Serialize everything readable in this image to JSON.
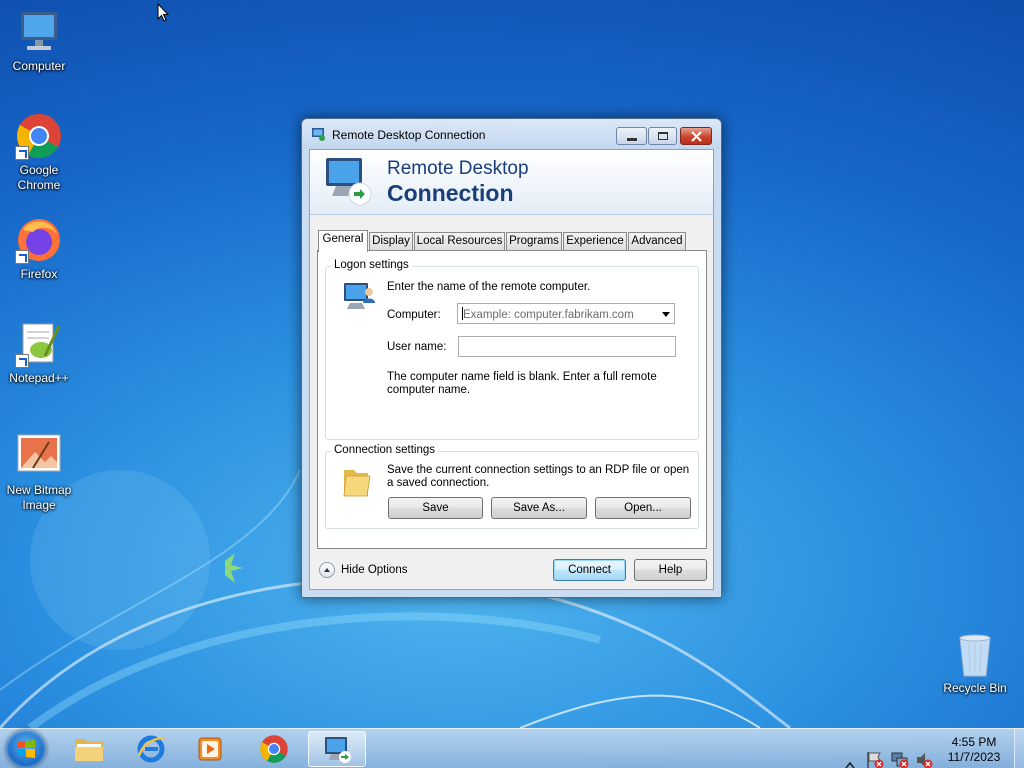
{
  "desktop": {
    "icons": [
      {
        "label": "Computer",
        "icon": "computer-icon"
      },
      {
        "label": "Google Chrome",
        "icon": "chrome-icon"
      },
      {
        "label": "Firefox",
        "icon": "firefox-icon"
      },
      {
        "label": "Notepad++",
        "icon": "notepadpp-icon"
      },
      {
        "label": "New Bitmap Image",
        "icon": "bitmap-image-icon"
      },
      {
        "label": "Recycle Bin",
        "icon": "recycle-bin-icon"
      }
    ]
  },
  "window": {
    "title": "Remote Desktop Connection",
    "banner_line1": "Remote Desktop",
    "banner_line2": "Connection",
    "tabs": [
      {
        "label": "General",
        "active": true
      },
      {
        "label": "Display"
      },
      {
        "label": "Local Resources"
      },
      {
        "label": "Programs"
      },
      {
        "label": "Experience"
      },
      {
        "label": "Advanced"
      }
    ],
    "logon": {
      "group_label": "Logon settings",
      "prompt": "Enter the name of the remote computer.",
      "computer_label": "Computer:",
      "computer_placeholder": "Example: computer.fabrikam.com",
      "username_label": "User name:",
      "username_value": "",
      "warning": "The computer name field is blank. Enter a full remote computer name."
    },
    "connection": {
      "group_label": "Connection settings",
      "description": "Save the current connection settings to an RDP file or open a saved connection.",
      "save_label": "Save",
      "save_as_label": "Save As...",
      "open_label": "Open..."
    },
    "hide_options_label": "Hide Options",
    "connect_label": "Connect",
    "help_label": "Help"
  },
  "taskbar": {
    "apps": [
      {
        "name": "file-explorer-icon"
      },
      {
        "name": "internet-explorer-icon"
      },
      {
        "name": "media-player-icon"
      },
      {
        "name": "chrome-icon"
      },
      {
        "name": "remote-desktop-icon",
        "active": true
      }
    ],
    "clock_time": "4:55 PM",
    "clock_date": "11/7/2023"
  },
  "colors": {
    "accent": "#1a3e7a",
    "desktop_blue": "#1767c9",
    "close_red": "#c9442d"
  }
}
